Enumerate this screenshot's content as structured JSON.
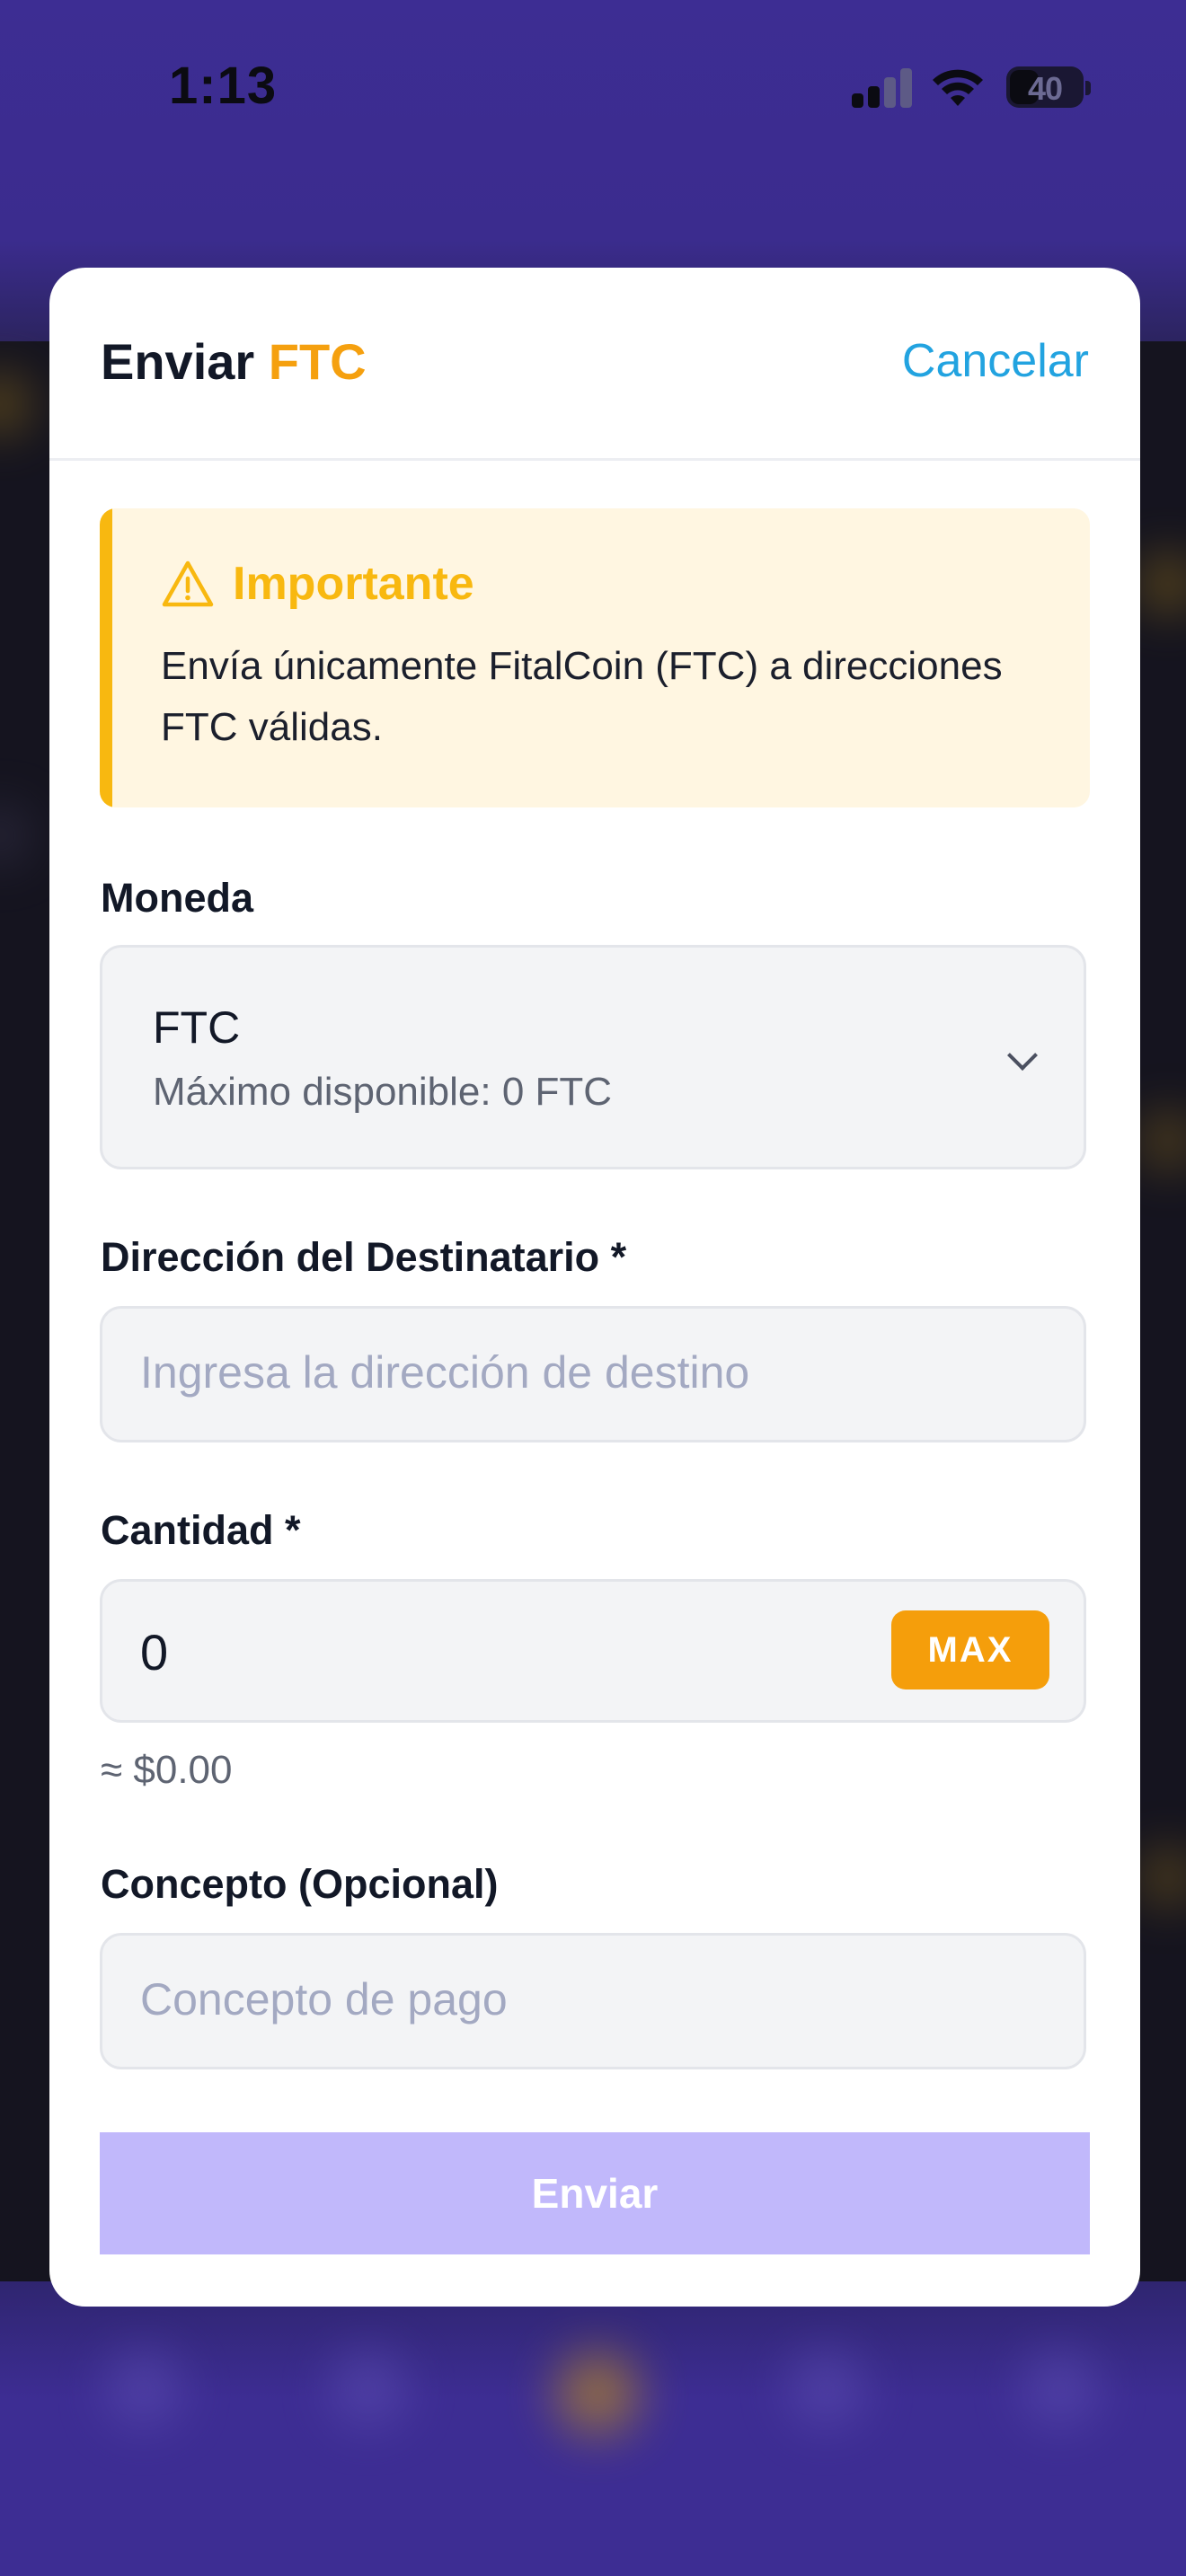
{
  "status_bar": {
    "time": "1:13",
    "battery": "40",
    "icons": [
      "signal-icon",
      "wifi-icon",
      "battery-icon"
    ]
  },
  "modal": {
    "title_prefix": "Enviar",
    "title_accent": "FTC",
    "cancel_label": "Cancelar"
  },
  "alert": {
    "icon": "warning-icon",
    "title": "Importante",
    "body": "Envía únicamente FitalCoin (FTC) a direcciones FTC válidas."
  },
  "currency": {
    "label": "Moneda",
    "selected": "FTC",
    "available": "Máximo disponible: 0 FTC",
    "icon": "chevron-down-icon"
  },
  "recipient": {
    "label": "Dirección del Destinatario *",
    "placeholder": "Ingresa la dirección de destino",
    "value": ""
  },
  "amount": {
    "label": "Cantidad *",
    "value": "0",
    "max_label": "MAX",
    "approx": "≈ $0.00"
  },
  "concept": {
    "label": "Concepto (Opcional)",
    "placeholder": "Concepto de pago",
    "value": ""
  },
  "submit": {
    "label": "Enviar"
  },
  "colors": {
    "accent": "#f5a00f",
    "link": "#22a3e0",
    "warning": "#f8b810",
    "primary_disabled": "#c1b8fb",
    "backdrop": "#3d2d93"
  }
}
